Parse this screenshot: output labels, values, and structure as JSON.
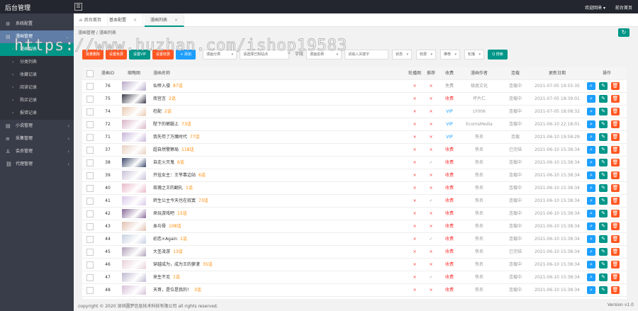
{
  "app": {
    "brand": "后台管理",
    "welcome": "欢迎回来 ▾",
    "home_link": "前台首页"
  },
  "sidebar": [
    {
      "label": "系统配置",
      "icon": "gear-icon"
    },
    {
      "label": "漫画管理",
      "icon": "book-icon"
    },
    {
      "label": "漫画列表",
      "sub": true,
      "active": true
    },
    {
      "label": "分类列表",
      "sub": true
    },
    {
      "label": "收藏记录",
      "sub": true
    },
    {
      "label": "阅读记录",
      "sub": true
    },
    {
      "label": "购买记录",
      "sub": true
    },
    {
      "label": "报错记录",
      "sub": true
    },
    {
      "label": "小说管理",
      "icon": "book-icon"
    },
    {
      "label": "采集管理",
      "icon": "list-icon"
    },
    {
      "label": "会员管理",
      "icon": "user-icon"
    },
    {
      "label": "代理管理",
      "icon": "link-icon"
    }
  ],
  "tabs": {
    "home": "后台首页",
    "basic": "基本配置",
    "list": "漫画列表"
  },
  "breadcrumb": "漫画管理  /  漫画列表",
  "toolbar": {
    "delete": "批量删除",
    "set_free": "设置免费",
    "set_vip": "设置VIP",
    "set_paid": "设置收费",
    "add": "+ 添加",
    "category": "漫画分类",
    "site": "请选择已知站点",
    "field_label": "字段",
    "field_value": "漫画名称",
    "keyword_placeholder": "请输入关键字",
    "status": "状态",
    "charge": "收费",
    "recommend": "推荐",
    "sort": "轮播",
    "search": "Q 搜索"
  },
  "columns": [
    "漫画ID",
    "缩略图",
    "漫画名称",
    "轮播图",
    "推荐",
    "收费",
    "漫画作者",
    "连载",
    "更新日期",
    "操作"
  ],
  "rows": [
    {
      "id": "76",
      "name": "仙帝入侵",
      "chapters": "87话",
      "rec": "x",
      "charge": "免费",
      "charge_type": "gray",
      "author": "极度文化",
      "serial": "连载中",
      "date": "2021-07-05 19:55:35"
    },
    {
      "id": "75",
      "name": "南宫言",
      "chapters": "2话",
      "rec": "x",
      "charge": "收费",
      "charge_type": "red",
      "author": "坏片仁",
      "serial": "连载中",
      "date": "2021-07-05 18:39:01"
    },
    {
      "id": "74",
      "name": "柱配",
      "chapters": "2话",
      "rec": "x",
      "charge": "VIP",
      "charge_type": "blue",
      "author": "LY006",
      "serial": "连载中",
      "date": "2021-07-05 18:08:32"
    },
    {
      "id": "72",
      "name": "陛下的裤腿上",
      "chapters": "73话",
      "rec": "x",
      "charge": "VIP",
      "charge_type": "blue",
      "author": "EcomsMedia",
      "serial": "连载中",
      "date": "2021-06-10 22:18:01"
    },
    {
      "id": "71",
      "name": "我先苟了万魔时代",
      "chapters": "77话",
      "rec": "x",
      "charge": "VIP",
      "charge_type": "blue",
      "author": "佚名",
      "serial": "连载",
      "date": "2021-06-10 19:58:29"
    },
    {
      "id": "37",
      "name": "超自然警察局",
      "chapters": "118话",
      "rec": "x",
      "charge": "收费",
      "charge_type": "red",
      "author": "佚名",
      "serial": "已完结",
      "date": "2021-06-10 15:38:34"
    },
    {
      "id": "38",
      "name": "自走火灭鬼",
      "chapters": "6话",
      "rec": "check",
      "charge": "收费",
      "charge_type": "red",
      "author": "佚名",
      "serial": "连载中",
      "date": "2021-06-10 15:38:34"
    },
    {
      "id": "39",
      "name": "开挂女主：王爷靠边站",
      "chapters": "6话",
      "rec": "x",
      "charge": "收费",
      "charge_type": "red",
      "author": "佚名",
      "serial": "连载中",
      "date": "2021-06-10 15:38:34"
    },
    {
      "id": "40",
      "name": "玫瑰之王的翻礼",
      "chapters": "1话",
      "rec": "x",
      "charge": "收费",
      "charge_type": "red",
      "author": "佚名",
      "serial": "连载中",
      "date": "2021-06-10 15:38:34"
    },
    {
      "id": "41",
      "name": "转生公主今天也在寂寞",
      "chapters": "73话",
      "rec": "check",
      "charge": "收费",
      "charge_type": "red",
      "author": "佚名",
      "serial": "连载中",
      "date": "2021-06-10 15:38:34"
    },
    {
      "id": "42",
      "name": "来玩游戏吧",
      "chapters": "15话",
      "rec": "x",
      "charge": "收费",
      "charge_type": "red",
      "author": "佚名",
      "serial": "连载中",
      "date": "2021-06-10 15:38:34"
    },
    {
      "id": "43",
      "name": "血与骨",
      "chapters": "108话",
      "rec": "x",
      "charge": "收费",
      "charge_type": "red",
      "author": "佚名",
      "serial": "连载中",
      "date": "2021-06-10 15:38:34"
    },
    {
      "id": "44",
      "name": "初恋×Again",
      "chapters": "1话",
      "rec": "check",
      "charge": "收费",
      "charge_type": "red",
      "author": "佚名",
      "serial": "连载中",
      "date": "2021-06-10 15:38:34"
    },
    {
      "id": "45",
      "name": "大圣凌游",
      "chapters": "13话",
      "rec": "x",
      "charge": "收费",
      "charge_type": "red",
      "author": "佚名",
      "serial": "已完结",
      "date": "2021-06-10 15:38:34"
    },
    {
      "id": "46",
      "name": "穿越成为，成为王的萝漾",
      "chapters": "35话",
      "rec": "x",
      "charge": "收费",
      "charge_type": "red",
      "author": "佚名",
      "serial": "连载中",
      "date": "2021-06-10 15:38:34"
    },
    {
      "id": "47",
      "name": "来生不见",
      "chapters": "1话",
      "rec": "check",
      "charge": "收费",
      "charge_type": "red",
      "author": "佚名",
      "serial": "连载中",
      "date": "2021-06-10 15:38:34"
    },
    {
      "id": "48",
      "name": "天哥，是位是我的！",
      "chapters": "3话",
      "rec": "x",
      "charge": "收费",
      "charge_type": "red",
      "author": "佚名",
      "serial": "连载中",
      "date": "2021-06-10 15:38:34"
    }
  ],
  "cover_colors": [
    "#b8a9c9",
    "#3a3a4a",
    "#e8c9b0",
    "#d9b3c7",
    "#c6b5d8",
    "#e7d0c0",
    "#3b4a6b",
    "#c9c0d8",
    "#e8b8c8",
    "#d8c8e8",
    "#8a6a9a",
    "#e0c0b0",
    "#c8d0e0",
    "#b0a0b8",
    "#e8d0d8",
    "#c0b8d0",
    "#d8c0d8"
  ],
  "colors": {
    "accent": "#009688",
    "danger": "#ff5722",
    "info": "#1e9fff",
    "warn": "#ffb800",
    "sidebar": "#393d49"
  },
  "footer": {
    "copyright": "copyright © 2020 深圳圆梦信息技术科技有限公司 all rights reserved.",
    "version": "Version v1.0"
  },
  "watermark": "https://www.huzhan.com/ishop19583"
}
